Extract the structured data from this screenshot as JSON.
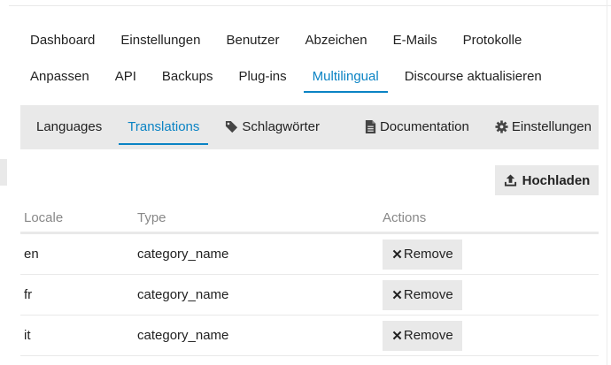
{
  "nav": {
    "row1": [
      "Dashboard",
      "Einstellungen",
      "Benutzer",
      "Abzeichen",
      "E-Mails",
      "Protokolle"
    ],
    "row2": [
      "Anpassen",
      "API",
      "Backups",
      "Plug-ins",
      "Multilingual",
      "Discourse aktualisieren"
    ],
    "active": "Multilingual"
  },
  "subnav": {
    "languages": "Languages",
    "translations": "Translations",
    "tags": "Schlagwörter",
    "documentation": "Documentation",
    "settings": "Einstellungen",
    "active": "Translations"
  },
  "upload_label": "Hochladen",
  "table": {
    "headers": {
      "locale": "Locale",
      "type": "Type",
      "actions": "Actions"
    },
    "rows": [
      {
        "locale": "en",
        "type": "category_name",
        "action": "Remove"
      },
      {
        "locale": "fr",
        "type": "category_name",
        "action": "Remove"
      },
      {
        "locale": "it",
        "type": "category_name",
        "action": "Remove"
      }
    ]
  },
  "icons": {
    "tag": "tag-icon",
    "documentation": "file-text-icon",
    "settings": "gear-icon",
    "upload": "upload-icon",
    "remove": "times-icon"
  },
  "colors": {
    "accent": "#0a83c4",
    "panel": "#e9e9e9",
    "muted": "#888888"
  }
}
